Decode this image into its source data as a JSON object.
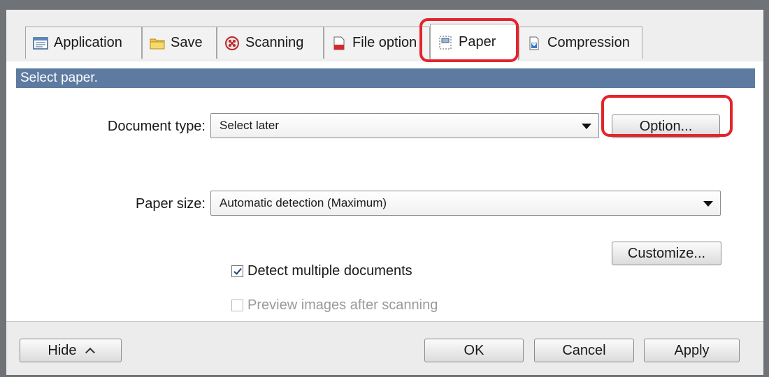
{
  "tabs": [
    {
      "label": "Application",
      "icon": "application-icon"
    },
    {
      "label": "Save",
      "icon": "folder-icon"
    },
    {
      "label": "Scanning",
      "icon": "scanning-icon"
    },
    {
      "label": "File option",
      "icon": "file-option-icon"
    },
    {
      "label": "Paper",
      "icon": "paper-icon",
      "active": true
    },
    {
      "label": "Compression",
      "icon": "compression-icon"
    }
  ],
  "header": {
    "title": "Select paper."
  },
  "document_type": {
    "label": "Document type:",
    "value": "Select later",
    "option_button": "Option..."
  },
  "paper_size": {
    "label": "Paper size:",
    "value": "Automatic detection (Maximum)",
    "customize_button": "Customize..."
  },
  "checkboxes": {
    "detect_multiple": {
      "label": "Detect multiple documents",
      "checked": true,
      "enabled": true
    },
    "preview_images": {
      "label": "Preview images after scanning",
      "checked": false,
      "enabled": false
    }
  },
  "footer": {
    "hide": "Hide",
    "ok": "OK",
    "cancel": "Cancel",
    "apply": "Apply"
  },
  "colors": {
    "header_strip": "#5d7ba0",
    "callout": "#e3242b",
    "frame": "#6f7378"
  }
}
